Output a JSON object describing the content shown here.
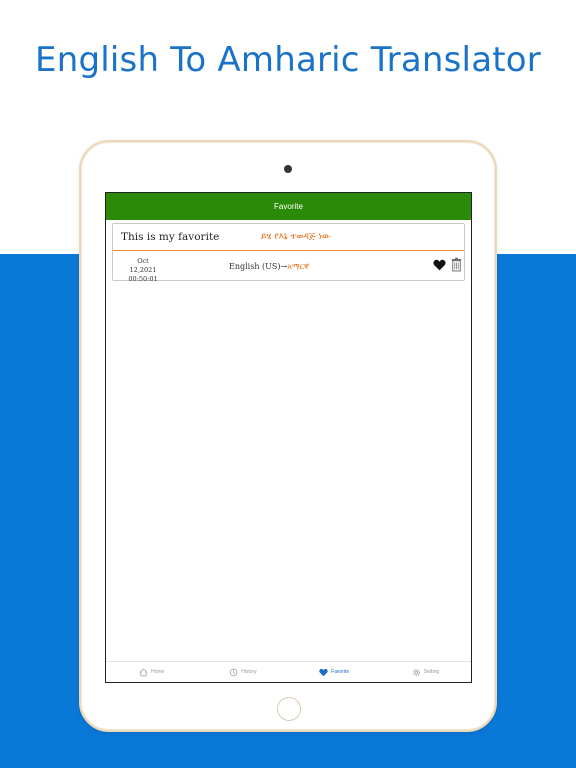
{
  "promo": {
    "headline": "English To Amharic Translator"
  },
  "app": {
    "navbar": {
      "title": "Favorite"
    },
    "favorites": [
      {
        "source_text": "This is my favorite",
        "translated_text": "ይሄ የእኔ ተወዳጅ ነው",
        "date": "Oct 12,2021",
        "time": "00:50:01",
        "source_lang": "English (US)",
        "arrow": "→",
        "target_lang": "አማርኛ"
      }
    ],
    "tabs": [
      {
        "label": "Home",
        "icon": "home-icon"
      },
      {
        "label": "History",
        "icon": "history-icon"
      },
      {
        "label": "Favorite",
        "icon": "heart-icon",
        "active": true
      },
      {
        "label": "Setting",
        "icon": "gear-icon"
      }
    ]
  },
  "colors": {
    "brand_blue": "#0a78d7",
    "navbar_green": "#2c8a09",
    "accent_orange": "#e86a10",
    "active_tab": "#1a6fc9"
  }
}
